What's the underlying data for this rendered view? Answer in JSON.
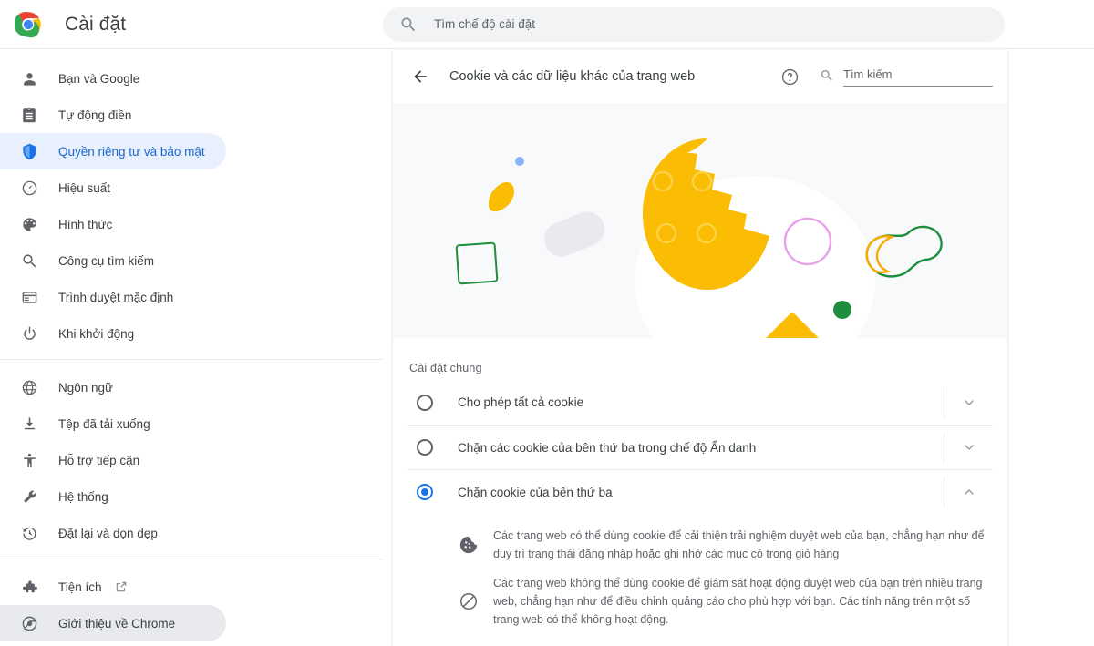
{
  "window": {
    "brand_title": "Cài đặt",
    "logo_name": "chrome-logo"
  },
  "top_search": {
    "placeholder": "Tìm chế độ cài đặt",
    "value": "",
    "icon": "search-icon"
  },
  "sidebar": {
    "groups": [
      {
        "items": [
          {
            "label": "Bạn và Google",
            "icon": "person-icon",
            "selected": false
          },
          {
            "label": "Tự động điền",
            "icon": "clipboard-icon",
            "selected": false
          },
          {
            "label": "Quyền riêng tư và bảo mật",
            "icon": "shield-icon",
            "selected": true
          },
          {
            "label": "Hiệu suất",
            "icon": "speedometer-icon",
            "selected": false
          },
          {
            "label": "Hình thức",
            "icon": "palette-icon",
            "selected": false
          },
          {
            "label": "Công cụ tìm kiếm",
            "icon": "search-icon",
            "selected": false
          },
          {
            "label": "Trình duyệt mặc định",
            "icon": "browser-window-icon",
            "selected": false
          },
          {
            "label": "Khi khởi động",
            "icon": "power-icon",
            "selected": false
          }
        ]
      },
      {
        "items": [
          {
            "label": "Ngôn ngữ",
            "icon": "globe-icon",
            "selected": false
          },
          {
            "label": "Tệp đã tải xuống",
            "icon": "download-icon",
            "selected": false
          },
          {
            "label": "Hỗ trợ tiếp cận",
            "icon": "accessibility-icon",
            "selected": false
          },
          {
            "label": "Hệ thống",
            "icon": "wrench-icon",
            "selected": false
          },
          {
            "label": "Đặt lại và dọn dẹp",
            "icon": "history-restore-icon",
            "selected": false
          }
        ]
      },
      {
        "items": [
          {
            "label": "Tiện ích",
            "icon": "puzzle-icon",
            "selected": false,
            "external": true
          },
          {
            "label": "Giới thiệu về Chrome",
            "icon": "chrome-icon",
            "selected": false,
            "grey": true
          }
        ]
      }
    ]
  },
  "page": {
    "back_icon": "arrow-left-icon",
    "title": "Cookie và các dữ liệu khác của trang web",
    "help_icon": "help-circle-icon",
    "search": {
      "icon": "search-icon",
      "placeholder": "Tìm kiếm",
      "value": ""
    },
    "hero": {
      "name": "cookie-illustration",
      "background": "#f7f9fa",
      "colors": {
        "cookie_yellow": "#fbbc04",
        "white_blob": "#ffffff",
        "grey_pill": "#e8eaed",
        "blue_dot": "#8ab4f8",
        "green_outline": "#1e8e3e",
        "pink_outline": "#e8a0e8",
        "blue_triangle": "#4285f4",
        "green_dot": "#1e8e3e"
      }
    },
    "section_title": "Cài đặt chung",
    "options": [
      {
        "label": "Cho phép tất cả cookie",
        "selected": false,
        "expanded": false,
        "chevron": "chevron-down-icon"
      },
      {
        "label": "Chặn các cookie của bên thứ ba trong chế độ Ẩn danh",
        "selected": false,
        "expanded": false,
        "chevron": "chevron-down-icon"
      },
      {
        "label": "Chặn cookie của bên thứ ba",
        "selected": true,
        "expanded": true,
        "chevron": "chevron-up-icon"
      }
    ],
    "details": [
      {
        "icon": "cookie-icon",
        "text": "Các trang web có thể dùng cookie để cải thiện trải nghiệm duyệt web của bạn, chẳng hạn như để duy trì trạng thái đăng nhập hoặc ghi nhớ các mục có trong giỏ hàng"
      },
      {
        "icon": "block-icon",
        "text": "Các trang web không thể dùng cookie để giám sát hoạt động duyệt web của bạn trên nhiều trang web, chẳng hạn như để điều chỉnh quảng cáo cho phù hợp với bạn. Các tính năng trên một số trang web có thể không hoạt động."
      }
    ]
  },
  "colors": {
    "accent": "#1a73e8",
    "selected_nav_bg": "#e8f0fe",
    "selected_nav_text": "#1967d2",
    "text_primary": "#3c4043",
    "text_secondary": "#5f6368"
  }
}
